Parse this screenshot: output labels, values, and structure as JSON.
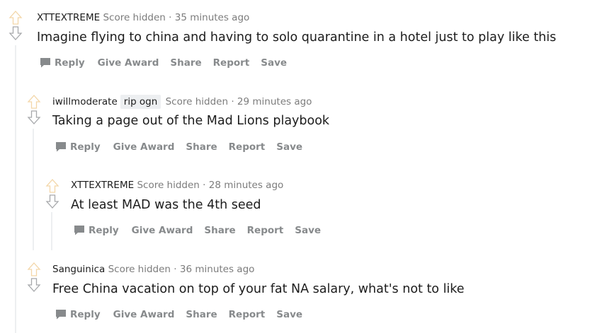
{
  "colors": {
    "upvote_outline": "#f3d6a8",
    "downvote_outline": "#a6a8ab",
    "thread_line": "#edeff1",
    "action_text": "#878a8c",
    "meta_text": "#7c7c7c"
  },
  "comments": [
    {
      "author": "XTTEXTREME",
      "flair": "",
      "score": "Score hidden",
      "separator": "·",
      "time": "35 minutes ago",
      "body": "Imagine flying to china and having to solo quarantine in a hotel just to play like this"
    },
    {
      "author": "iwillmoderate",
      "flair": "rip ogn",
      "score": "Score hidden",
      "separator": "·",
      "time": "29 minutes ago",
      "body": "Taking a page out of the Mad Lions playbook"
    },
    {
      "author": "XTTEXTREME",
      "flair": "",
      "score": "Score hidden",
      "separator": "·",
      "time": "28 minutes ago",
      "body": "At least MAD was the 4th seed"
    },
    {
      "author": "Sanguinica",
      "flair": "",
      "score": "Score hidden",
      "separator": "·",
      "time": "36 minutes ago",
      "body": "Free China vacation on top of your fat NA salary, what's not to like"
    }
  ],
  "actions": {
    "reply": "Reply",
    "give_award": "Give Award",
    "share": "Share",
    "report": "Report",
    "save": "Save"
  },
  "icons": {
    "upvote": "arrow-up-outline-icon",
    "downvote": "arrow-down-outline-icon",
    "reply": "speech-bubble-icon"
  }
}
